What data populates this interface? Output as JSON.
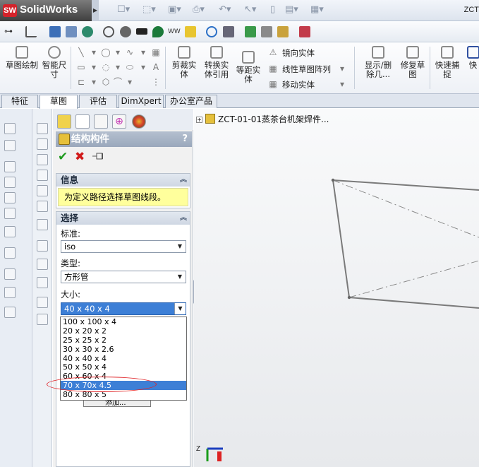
{
  "app": {
    "brand_badge": "SW",
    "brand": "SolidWorks",
    "title_right": "ZCT"
  },
  "ribbon": {
    "sketch_draw": "草图绘制",
    "smart_dim": "智能尺寸",
    "trim": "剪裁实体",
    "convert": "转换实体引用",
    "offset": "等距实体",
    "mirror": "镜向实体",
    "linear_pattern": "线性草图阵列",
    "move": "移动实体",
    "show_delete": "显示/删除几...",
    "repair": "修复草图",
    "quick_snap": "快速捕捉",
    "cut_label": "快"
  },
  "tabs": [
    {
      "label": "特征"
    },
    {
      "label": "草图"
    },
    {
      "label": "评估"
    },
    {
      "label": "DimXpert"
    },
    {
      "label": "办公室产品"
    }
  ],
  "pm": {
    "title": "结构构件",
    "help": "?",
    "info_title": "信息",
    "info_msg": "为定义路径选择草图线段。",
    "select_title": "选择",
    "standard_label": "标准:",
    "standard_value": "iso",
    "type_label": "类型:",
    "type_value": "方形管",
    "size_label": "大小:",
    "size_value": "40 x 40 x 4",
    "size_options": [
      "100 x 100 x 4",
      "20 x 20 x 2",
      "25 x 25 x 2",
      "30 x 30 x 2.6",
      "40 x 40 x 4",
      "50 x 50 x 4",
      "60 x 60 x 4",
      "70 x 70x 4.5",
      "80 x 80 x 5"
    ],
    "selected_option": "70 x 70x 4.5",
    "hidden_button_text": "添加..."
  },
  "tree": {
    "root_label": "ZCT-01-01蒸茶台机架焊件..."
  },
  "axes": {
    "z_label": "Z"
  },
  "colors": {
    "accent": "#3d7fd6",
    "info_bg": "#ffff9c",
    "highlight_oval": "#e0262a",
    "panel_header": "#9aa8bc"
  }
}
